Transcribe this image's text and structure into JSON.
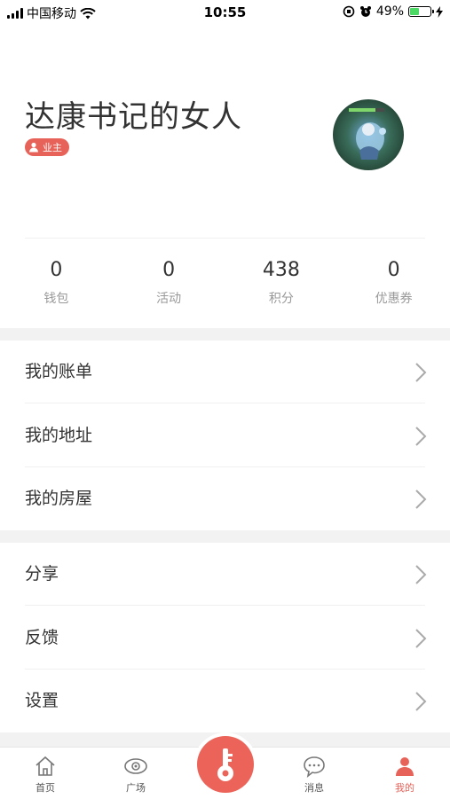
{
  "status_bar": {
    "carrier": "中国移动",
    "time": "10:55",
    "battery_percent": "49%",
    "battery_level": 0.49
  },
  "profile": {
    "name": "达康书记的女人",
    "role": "业主"
  },
  "stats": [
    {
      "value": "0",
      "label": "钱包"
    },
    {
      "value": "0",
      "label": "活动"
    },
    {
      "value": "438",
      "label": "积分"
    },
    {
      "value": "0",
      "label": "优惠券"
    }
  ],
  "menu_group_1": [
    {
      "label": "我的账单"
    },
    {
      "label": "我的地址"
    },
    {
      "label": "我的房屋"
    }
  ],
  "menu_group_2": [
    {
      "label": "分享"
    },
    {
      "label": "反馈"
    },
    {
      "label": "设置"
    }
  ],
  "tabbar": {
    "tabs": [
      {
        "label": "首页",
        "icon": "home-icon"
      },
      {
        "label": "广场",
        "icon": "eye-icon"
      },
      {
        "label": "消息",
        "icon": "message-icon"
      },
      {
        "label": "我的",
        "icon": "user-icon",
        "active": true
      }
    ],
    "center_icon": "key-icon"
  },
  "colors": {
    "accent": "#e7635a",
    "separator": "#f2f2f2"
  }
}
